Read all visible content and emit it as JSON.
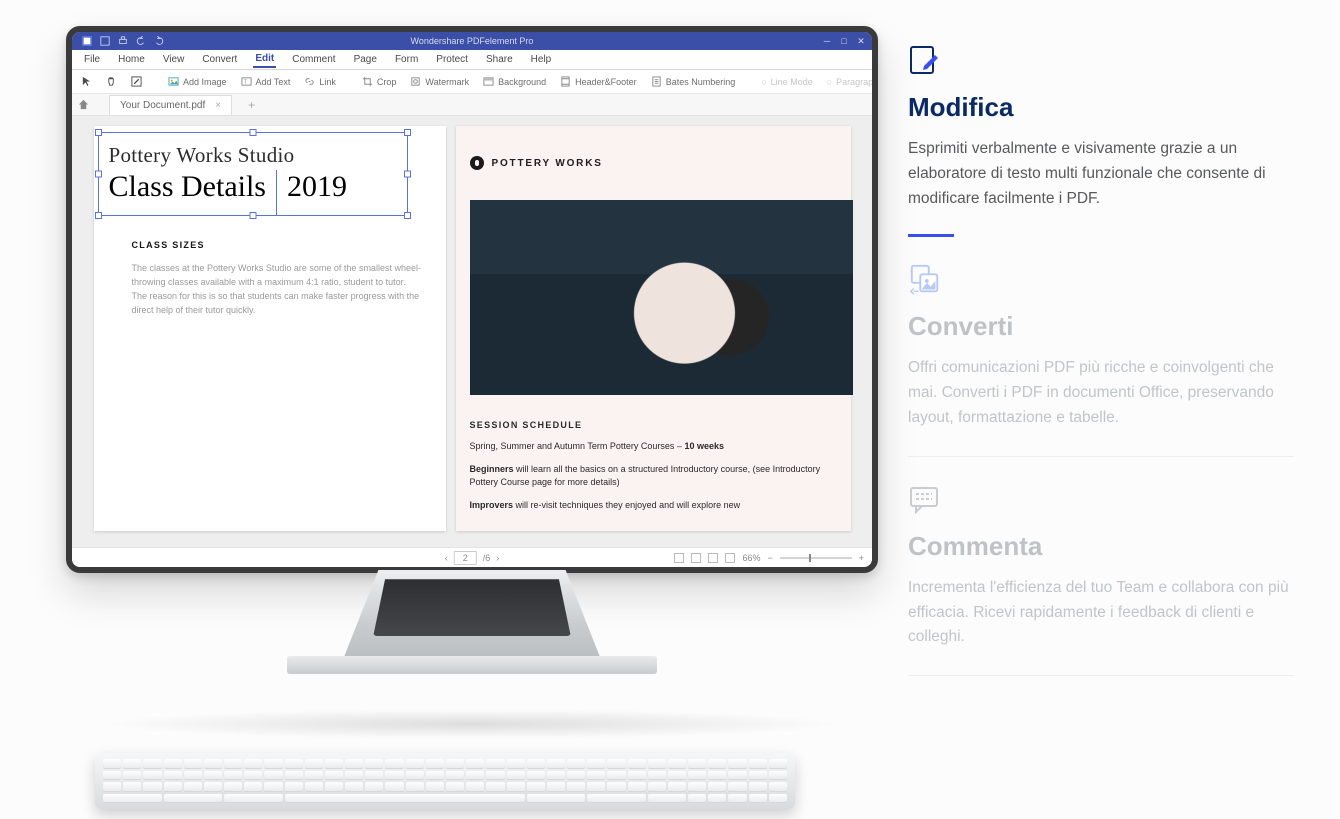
{
  "app": {
    "title": "Wondershare PDFelement Pro"
  },
  "menubar": [
    "File",
    "Home",
    "View",
    "Convert",
    "Edit",
    "Comment",
    "Page",
    "Form",
    "Protect",
    "Share",
    "Help"
  ],
  "menubar_active": "Edit",
  "toolbar": {
    "add_image": "Add Image",
    "add_text": "Add Text",
    "link": "Link",
    "crop": "Crop",
    "watermark": "Watermark",
    "background": "Background",
    "header_footer": "Header&Footer",
    "bates": "Bates Numbering",
    "line_mode": "Line Mode",
    "paragraph_mode": "Paragraph Mode"
  },
  "tab": {
    "filename": "Your Document.pdf"
  },
  "doc": {
    "left": {
      "subtitle": "Pottery Works Studio",
      "title": "Class Details",
      "year": "2019",
      "sec_head": "CLASS SIZES",
      "sec_p": "The classes at the Pottery Works Studio are some of the smallest wheel-throwing classes available with a maximum 4:1 ratio, student to tutor. The reason for this is so that students can make faster progress with the direct help of their tutor quickly."
    },
    "right": {
      "brand": "POTTERY WORKS",
      "sec_head": "SESSION SCHEDULE",
      "line1_a": "Spring, Summer and Autumn Term Pottery Courses – ",
      "line1_b": "10 weeks",
      "line2_a": "Beginners",
      "line2_b": " will learn all the basics on a structured Introductory course, (see Introductory Pottery Course page for more details)",
      "line3_a": "Improvers",
      "line3_b": " will re-visit techniques they enjoyed and will explore new"
    }
  },
  "status": {
    "page": "2",
    "total": "/6",
    "zoom": "66%"
  },
  "features": [
    {
      "key": "modifica",
      "title": "Modifica",
      "desc": "Esprimiti verbalmente e visivamente grazie a un elaboratore di testo multi funzionale che consente di modificare facilmente i PDF.",
      "active": true
    },
    {
      "key": "converti",
      "title": "Converti",
      "desc": "Offri comunicazioni PDF più ricche e coinvolgenti che mai. Converti i PDF in documenti Office, preservando layout, formattazione e tabelle.",
      "active": false
    },
    {
      "key": "commenta",
      "title": "Commenta",
      "desc": "Incrementa l'efficienza del tuo Team e collabora con più efficacia. Ricevi rapidamente i feedback di clienti e colleghi.",
      "active": false
    }
  ]
}
